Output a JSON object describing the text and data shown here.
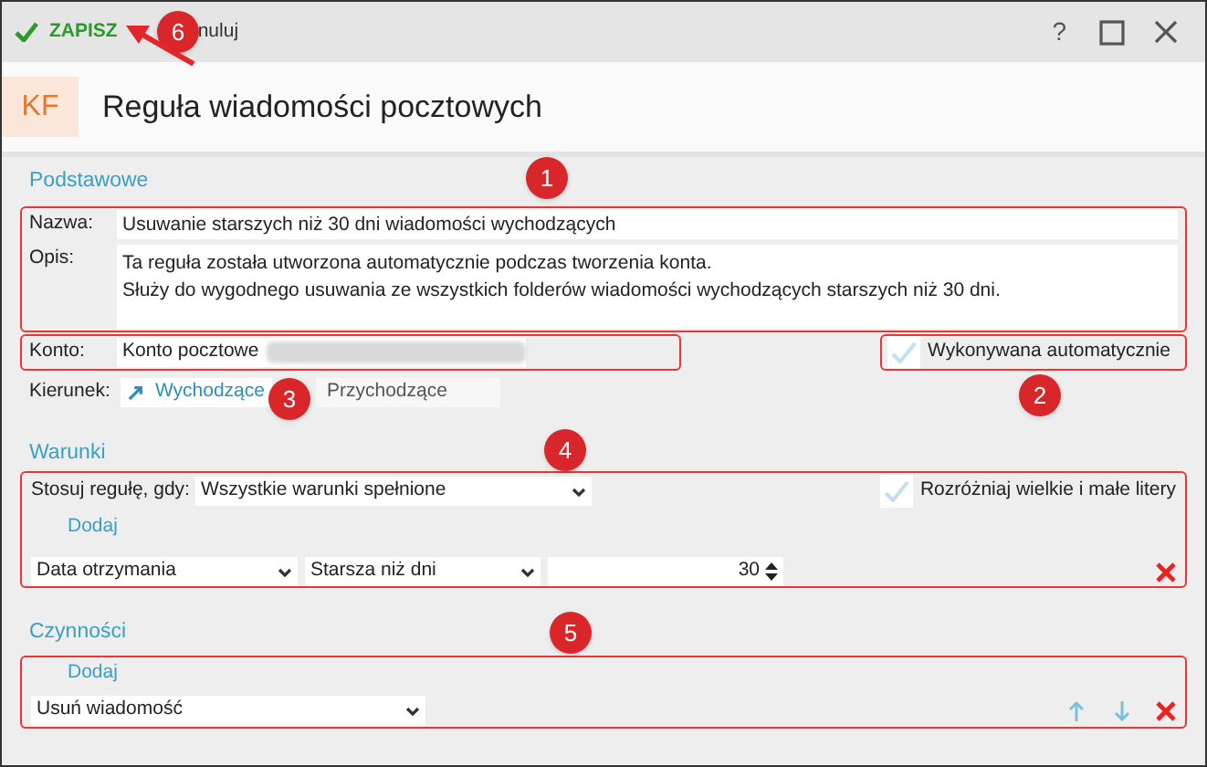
{
  "toolbar": {
    "save": "ZAPISZ",
    "cancel": "nuluj",
    "help": "?"
  },
  "header": {
    "badge": "KF",
    "title": "Reguła wiadomości pocztowych"
  },
  "basic": {
    "heading": "Podstawowe",
    "name_label": "Nazwa:",
    "name_value": "Usuwanie starszych niż 30 dni wiadomości wychodzących",
    "description_label": "Opis:",
    "description_lines": [
      "Ta reguła została utworzona automatycznie podczas tworzenia konta.",
      "Służy do wygodnego usuwania ze wszystkich folderów wiadomości wychodzących starszych niż 30 dni."
    ],
    "account_label": "Konto:",
    "account_value": "Konto pocztowe",
    "auto_run": {
      "label": "Wykonywana automatycznie",
      "checked": true
    },
    "direction_label": "Kierunek:",
    "directions": [
      {
        "label": "Wychodzące",
        "selected": true
      },
      {
        "label": "Przychodzące",
        "selected": false
      }
    ]
  },
  "conditions": {
    "heading": "Warunki",
    "apply_label": "Stosuj regułę, gdy:",
    "apply_value": "Wszystkie warunki spełnione",
    "case_sensitive": {
      "label": "Rozróżniaj wielkie i małe litery",
      "checked": true
    },
    "add": "Dodaj",
    "rows": [
      {
        "field": "Data otrzymania",
        "operator": "Starsza niż dni",
        "value": "30"
      }
    ]
  },
  "actions": {
    "heading": "Czynności",
    "add": "Dodaj",
    "rows": [
      {
        "action": "Usuń wiadomość"
      }
    ]
  },
  "annotations": [
    {
      "number": "1"
    },
    {
      "number": "2"
    },
    {
      "number": "3"
    },
    {
      "number": "4"
    },
    {
      "number": "5"
    },
    {
      "number": "6"
    }
  ]
}
